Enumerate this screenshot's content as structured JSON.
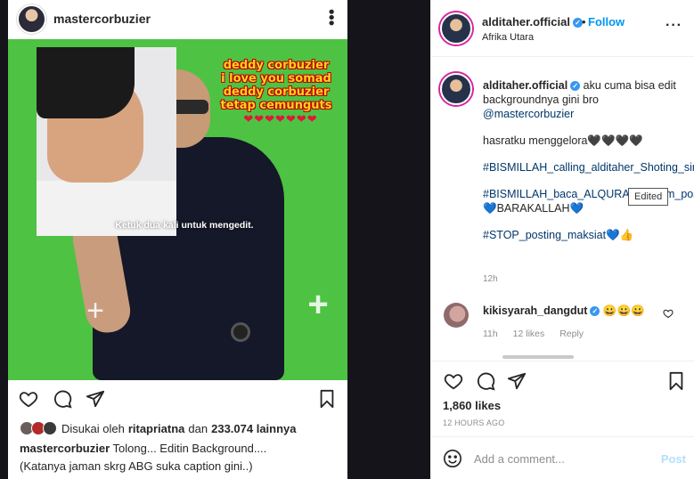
{
  "left_post": {
    "username": "mastercorbuzier",
    "more_icon": "more-vertical-icon",
    "overlay_lines": [
      "deddy corbuzier",
      "i love you somad",
      "deddy corbuzier",
      "tetap cemunguts"
    ],
    "overlay_hearts": "❤❤❤❤❤❤❤",
    "edit_hint": "Ketuk dua kali untuk mengedit.",
    "liked_prefix": "Disukai oleh",
    "liked_user": "ritapriatna",
    "liked_and": "dan",
    "liked_count": "233.074 lainnya",
    "caption_user": "mastercorbuzier",
    "caption_text": "Tolong... Editin Background....",
    "caption_line2": "(Katanya jaman skrg ABG suka caption gini..)"
  },
  "right_post": {
    "username": "alditaher.official",
    "follow_label": "Follow",
    "location": "Afrika Utara",
    "caption_user": "alditaher.official",
    "caption_text": "aku cuma bisa edit backgroundnya gini bro",
    "caption_mention": "@mastercorbuzier",
    "caption_line2": "hasratku menggelora🖤🖤🖤🖤",
    "caption_tag1": "#BISMILLAH_calling_alditaher_Shoting_sinetron_lagi",
    "caption_tag2": "#BISMILLAH_baca_ALQURAN_rekam_posting",
    "caption_tag2_suffix": "💙BARAKALLAH💙",
    "caption_tag3": "#STOP_posting_maksiat",
    "caption_tag3_suffix": "💙👍",
    "caption_time": "12h",
    "edited_tooltip": "Edited",
    "comment": {
      "username": "kikisyarah_dangdut",
      "text": "😀😀😀",
      "time": "11h",
      "likes": "12 likes",
      "reply_label": "Reply"
    },
    "likes": "1,860 likes",
    "time_ago": "12 HOURS AGO",
    "add_comment_placeholder": "Add a comment...",
    "post_label": "Post"
  },
  "colors": {
    "link_blue": "#0095f6",
    "verified_blue": "#3897f0",
    "green_screen": "#4ec243",
    "overlay_yellow": "#ffd21e",
    "post_disabled": "#b2dffc"
  }
}
